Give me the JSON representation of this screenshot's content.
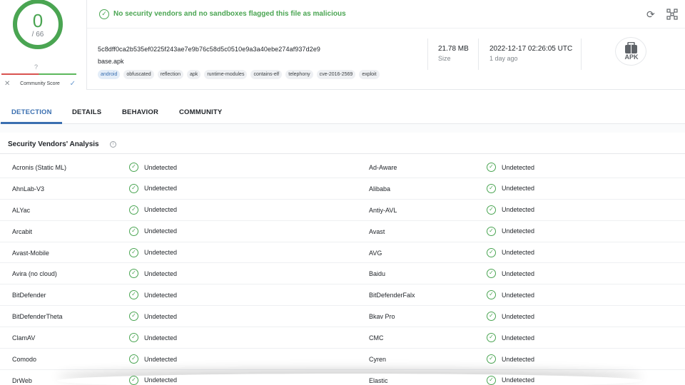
{
  "score": {
    "detections": "0",
    "total": "/ 66",
    "community_unknown": "?",
    "community_label": "Community Score",
    "ring_color": "#4aa552"
  },
  "banner": {
    "text": "No security vendors and no sandboxes flagged this file as malicious",
    "color": "#4aa552"
  },
  "file": {
    "hash": "5c8dff0ca2b535ef0225f243ae7e9b76c58d5c0510e9a3a40ebe274af937d2e9",
    "name": "base.apk",
    "tags": [
      "android",
      "obfuscated",
      "reflection",
      "apk",
      "runtime-modules",
      "contains-elf",
      "telephony",
      "cve-2016-2569",
      "exploit"
    ],
    "size_value": "21.78 MB",
    "size_label": "Size",
    "date_value": "2022-12-17 02:26:05 UTC",
    "date_label": "1 day ago",
    "type_badge": "APK"
  },
  "tabs": [
    {
      "label": "DETECTION"
    },
    {
      "label": "DETAILS"
    },
    {
      "label": "BEHAVIOR"
    },
    {
      "label": "COMMUNITY"
    }
  ],
  "vendors_section": {
    "title": "Security Vendors' Analysis"
  },
  "vendors": [
    {
      "left": "Acronis (Static ML)",
      "left_result": "Undetected",
      "right": "Ad-Aware",
      "right_result": "Undetected"
    },
    {
      "left": "AhnLab-V3",
      "left_result": "Undetected",
      "right": "Alibaba",
      "right_result": "Undetected"
    },
    {
      "left": "ALYac",
      "left_result": "Undetected",
      "right": "Antiy-AVL",
      "right_result": "Undetected"
    },
    {
      "left": "Arcabit",
      "left_result": "Undetected",
      "right": "Avast",
      "right_result": "Undetected"
    },
    {
      "left": "Avast-Mobile",
      "left_result": "Undetected",
      "right": "AVG",
      "right_result": "Undetected"
    },
    {
      "left": "Avira (no cloud)",
      "left_result": "Undetected",
      "right": "Baidu",
      "right_result": "Undetected"
    },
    {
      "left": "BitDefender",
      "left_result": "Undetected",
      "right": "BitDefenderFalx",
      "right_result": "Undetected"
    },
    {
      "left": "BitDefenderTheta",
      "left_result": "Undetected",
      "right": "Bkav Pro",
      "right_result": "Undetected"
    },
    {
      "left": "ClamAV",
      "left_result": "Undetected",
      "right": "CMC",
      "right_result": "Undetected"
    },
    {
      "left": "Comodo",
      "left_result": "Undetected",
      "right": "Cyren",
      "right_result": "Undetected"
    },
    {
      "left": "DrWeb",
      "left_result": "Undetected",
      "right": "Elastic",
      "right_result": "Undetected"
    }
  ],
  "icons": {
    "clean": "check-circle-icon",
    "refresh": "refresh-icon",
    "graph": "graph-icon",
    "info": "info-icon"
  },
  "colors": {
    "accent": "#3a6fb0",
    "clean": "#4aa552",
    "negative": "#d9534f"
  }
}
